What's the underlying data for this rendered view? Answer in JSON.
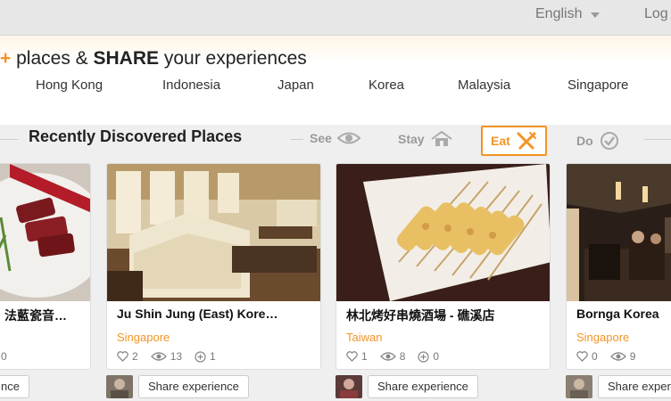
{
  "header": {
    "language": "English",
    "login": "Log"
  },
  "hero": {
    "plus": "+",
    "tagline_1": "places & ",
    "tagline_bold": "SHARE",
    "tagline_2": " your experiences",
    "countries": [
      "Hong Kong",
      "Indonesia",
      "Japan",
      "Korea",
      "Malaysia",
      "Singapore"
    ]
  },
  "section": {
    "title": "Recently Discovered Places",
    "filters": [
      {
        "label": "See",
        "icon": "eye-icon",
        "active": false
      },
      {
        "label": "Stay",
        "icon": "house-icon",
        "active": false
      },
      {
        "label": "Eat",
        "icon": "utensils-icon",
        "active": true
      },
      {
        "label": "Do",
        "icon": "checkmark-circle-icon",
        "active": false
      }
    ]
  },
  "cards": [
    {
      "name": "法藍瓷音…",
      "location": "",
      "likes": "0",
      "views": "",
      "adds": "",
      "share": "nce"
    },
    {
      "name": "Ju Shin Jung (East) Kore…",
      "location": "Singapore",
      "likes": "2",
      "views": "13",
      "adds": "1",
      "share": "Share experience"
    },
    {
      "name": "林北烤好串燒酒場 - 礁溪店",
      "location": "Taiwan",
      "likes": "1",
      "views": "8",
      "adds": "0",
      "share": "Share experience"
    },
    {
      "name": "Bornga Korea",
      "location": "Singapore",
      "likes": "0",
      "views": "9",
      "adds": "",
      "share": "Share experie"
    }
  ],
  "colors": {
    "accent": "#f39425",
    "topbar": "#e7e7e7",
    "text_muted": "#777777"
  }
}
